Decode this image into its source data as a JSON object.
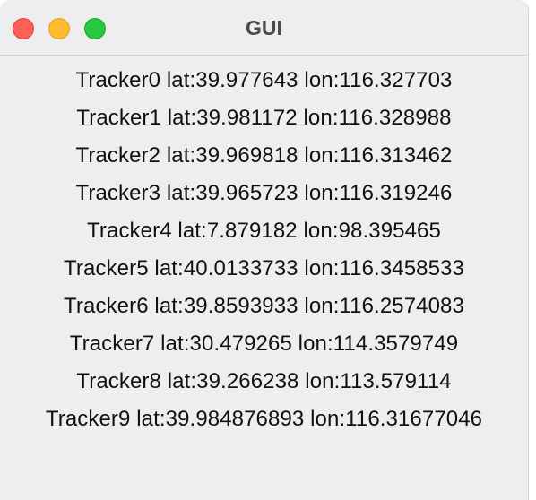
{
  "window": {
    "title": "GUI"
  },
  "trackers": [
    "Tracker0 lat:39.977643 lon:116.327703",
    "Tracker1 lat:39.981172 lon:116.328988",
    "Tracker2 lat:39.969818 lon:116.313462",
    "Tracker3 lat:39.965723 lon:116.319246",
    "Tracker4 lat:7.879182 lon:98.395465",
    "Tracker5 lat:40.0133733 lon:116.3458533",
    "Tracker6 lat:39.8593933 lon:116.2574083",
    "Tracker7 lat:30.479265 lon:114.3579749",
    "Tracker8 lat:39.266238 lon:113.579114",
    "Tracker9 lat:39.984876893 lon:116.31677046"
  ],
  "colors": {
    "close": "#fe5f57",
    "minimize": "#febc2e",
    "zoom": "#28c840",
    "background": "#eeeeee"
  }
}
